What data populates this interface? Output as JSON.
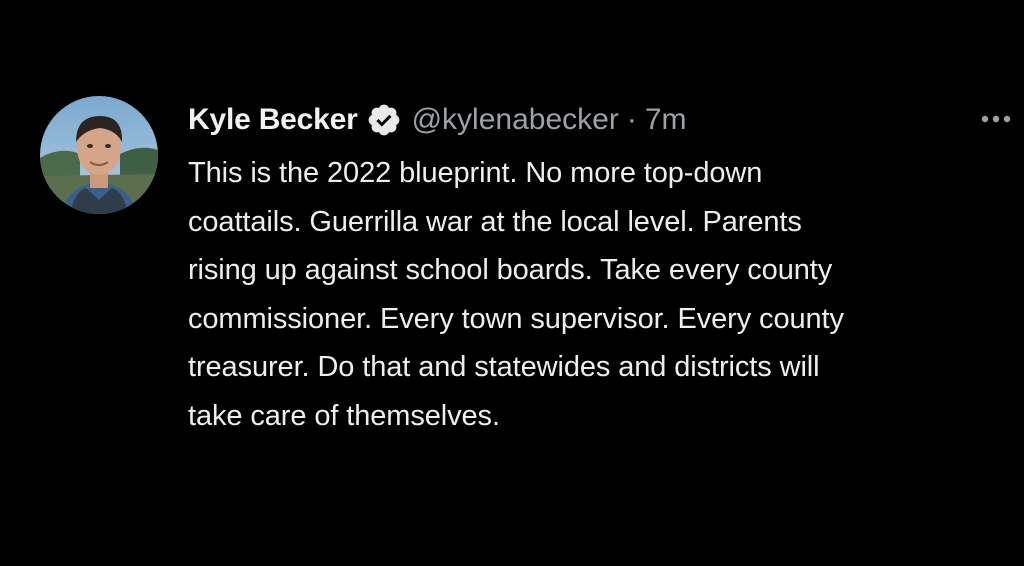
{
  "tweet": {
    "author": {
      "display_name": "Kyle Becker",
      "handle": "@kylenabecker",
      "verified": true,
      "avatar_icon": "profile-photo"
    },
    "separator": "·",
    "timestamp": "7m",
    "more_icon": "more-horizontal-icon",
    "text_lines": [
      "This is the 2022 blueprint. No more top-down",
      "coattails. Guerrilla war at the local level. Parents",
      "rising up against school boards. Take every county",
      "commissioner. Every town supervisor. Every county",
      "treasurer. Do that and statewides and districts will",
      "take care of themselves."
    ]
  },
  "colors": {
    "background": "#000000",
    "primary_text": "#e7e9ea",
    "secondary_text": "#9da1a6",
    "verified_badge": "#e7e9ea"
  }
}
